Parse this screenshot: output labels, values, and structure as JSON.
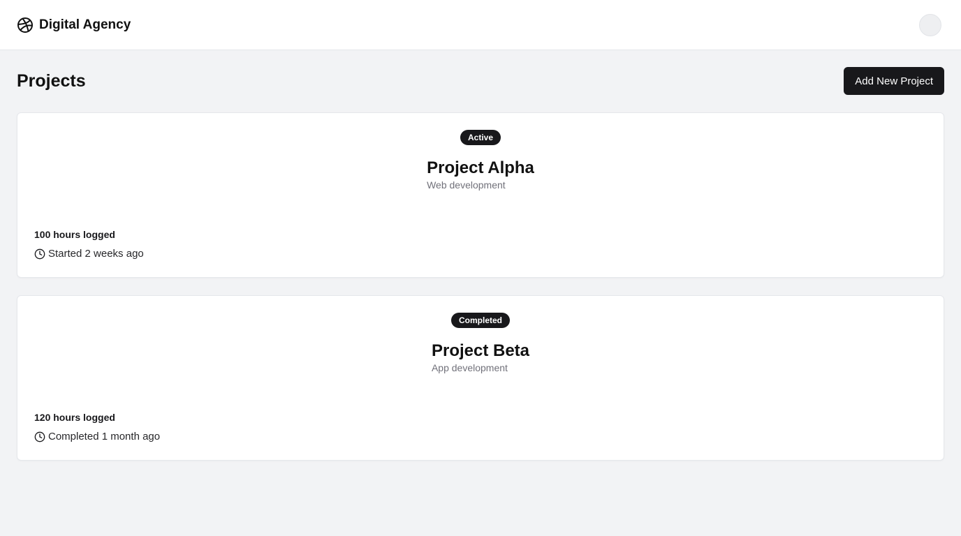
{
  "header": {
    "brand_icon": "dribbble-icon",
    "brand_name": "Digital Agency",
    "avatar": "user-avatar"
  },
  "page": {
    "title": "Projects",
    "add_button_label": "Add New Project"
  },
  "projects": [
    {
      "status": "Active",
      "title": "Project Alpha",
      "category": "Web development",
      "hours": "100 hours logged",
      "timeline_icon": "clock-icon",
      "timeline": "Started 2 weeks ago"
    },
    {
      "status": "Completed",
      "title": "Project Beta",
      "category": "App development",
      "hours": "120 hours logged",
      "timeline_icon": "clock-icon",
      "timeline": "Completed 1 month ago"
    }
  ],
  "colors": {
    "background": "#f2f3f5",
    "card": "#ffffff",
    "primary_dark": "#18181b",
    "muted_text": "#71717a"
  }
}
